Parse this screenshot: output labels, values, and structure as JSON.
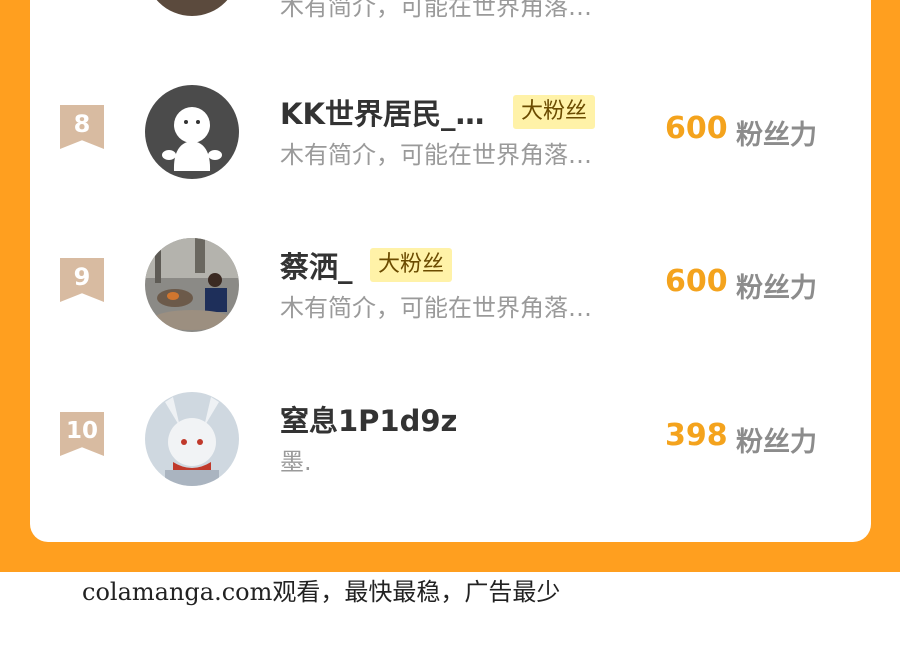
{
  "rows": [
    {
      "rank": "",
      "name": "",
      "badge": "",
      "desc": "木有简介，可能在世界角落…",
      "score": "",
      "unit": ""
    },
    {
      "rank": "8",
      "name": "KK世界居民_…",
      "badge": "大粉丝",
      "desc": "木有简介，可能在世界角落…",
      "score": "600",
      "unit": "粉丝力"
    },
    {
      "rank": "9",
      "name": "蔡洒_",
      "badge": "大粉丝",
      "desc": "木有简介，可能在世界角落…",
      "score": "600",
      "unit": "粉丝力"
    },
    {
      "rank": "10",
      "name": "窒息1P1d9z",
      "badge": "",
      "desc": "墨.",
      "score": "398",
      "unit": "粉丝力"
    }
  ],
  "footer": "colamanga.com观看，最快最稳，广告最少",
  "colors": {
    "background": "#ff9f1f",
    "score": "#f4a31d",
    "badge_bg": "#fff2a8"
  }
}
